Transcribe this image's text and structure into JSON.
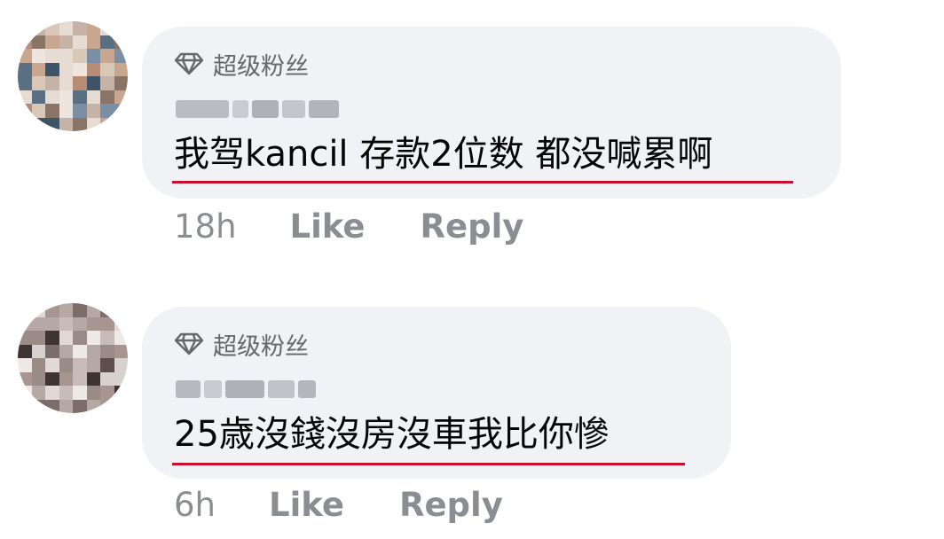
{
  "comments": [
    {
      "badge": "超级粉丝",
      "author": "Chin Tat",
      "text": "我驾kancil 存款2位数 都没喊累啊",
      "time": "18h",
      "like": "Like",
      "reply": "Reply"
    },
    {
      "badge": "超级粉丝",
      "author": "Ah Seng",
      "text": "25歳沒錢沒房沒車我比你慘",
      "time": "6h",
      "like": "Like",
      "reply": "Reply"
    }
  ],
  "colors": {
    "bubble": "#f0f2f5",
    "meta": "#65676b",
    "actions": "#8a8d91",
    "underline": "#c8102e"
  },
  "icons": {
    "badge": "diamond-icon"
  }
}
